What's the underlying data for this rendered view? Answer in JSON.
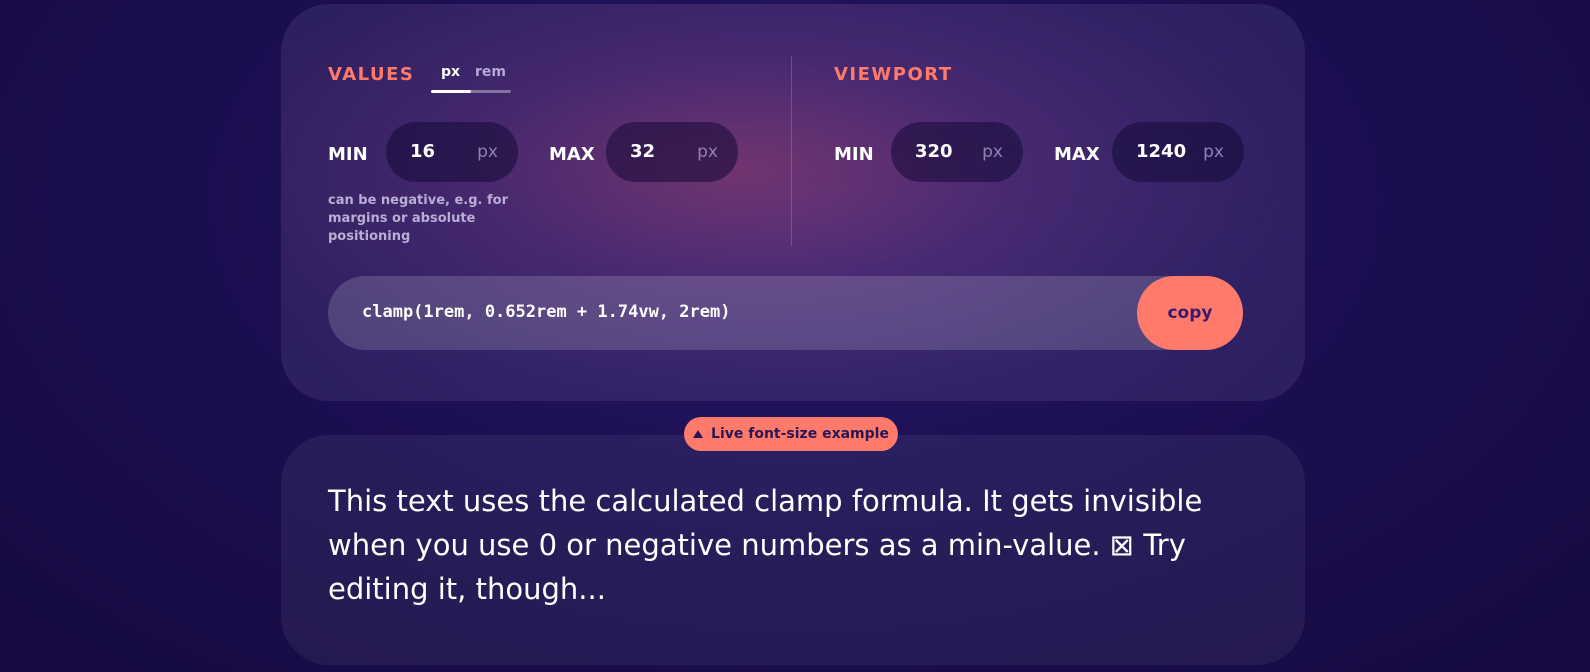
{
  "values": {
    "title": "VALUES",
    "units": {
      "px_label": "px",
      "rem_label": "rem",
      "selected": "px"
    },
    "min_label": "MIN",
    "min_value": "16",
    "min_unit": "px",
    "max_label": "MAX",
    "max_value": "32",
    "max_unit": "px",
    "hint": "can be negative, e.g. for margins or absolute positioning"
  },
  "viewport": {
    "title": "VIEWPORT",
    "min_label": "MIN",
    "min_value": "320",
    "min_unit": "px",
    "max_label": "MAX",
    "max_value": "1240",
    "max_unit": "px"
  },
  "output": {
    "formula": "clamp(1rem, 0.652rem + 1.74vw, 2rem)",
    "copy_label": "copy"
  },
  "live": {
    "badge_label": "Live font-size example",
    "icon": "triangle-up-icon",
    "sample_text": "This text uses the calculated clamp formula. It gets invisible when you use 0 or negative numbers as a min-value. ⊠ Try editing it, though..."
  },
  "colors": {
    "accent": "#ff7a6b",
    "background": "#1c0f52",
    "card": "rgba(255,255,255,0.07)"
  }
}
